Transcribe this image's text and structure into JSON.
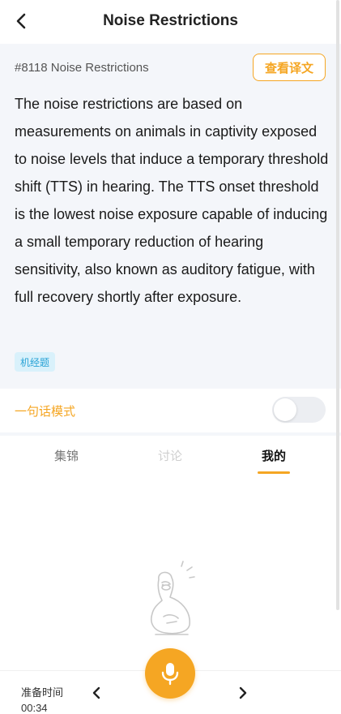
{
  "header": {
    "title": "Noise Restrictions",
    "back_icon": "chevron-left-icon"
  },
  "question": {
    "id_line": "#8118  Noise Restrictions",
    "translate_label": "查看译文",
    "passage": "The noise restrictions are based on measurements on animals in captivity exposed to noise levels that induce a temporary threshold shift (TTS) in hearing. The TTS onset threshold is the lowest noise exposure capable of inducing a small temporary reduction of hearing sensitivity, also known as auditory fatigue, with full recovery shortly after exposure.",
    "tag": "机经题"
  },
  "mode": {
    "label": "一句话模式",
    "enabled": false
  },
  "tabs": [
    {
      "label": "集锦",
      "active": false
    },
    {
      "label": "讨论",
      "active": false
    },
    {
      "label": "我的",
      "active": true
    }
  ],
  "bottom": {
    "prep_label": "准备时间",
    "prep_time": "00:34",
    "prev_icon": "chevron-left-icon",
    "next_icon": "chevron-right-icon",
    "mic_icon": "microphone-icon"
  },
  "colors": {
    "accent": "#f5a623",
    "tag_bg": "#d9f1fb",
    "tag_text": "#2aa3d6",
    "card_bg": "#f4f6fa"
  }
}
